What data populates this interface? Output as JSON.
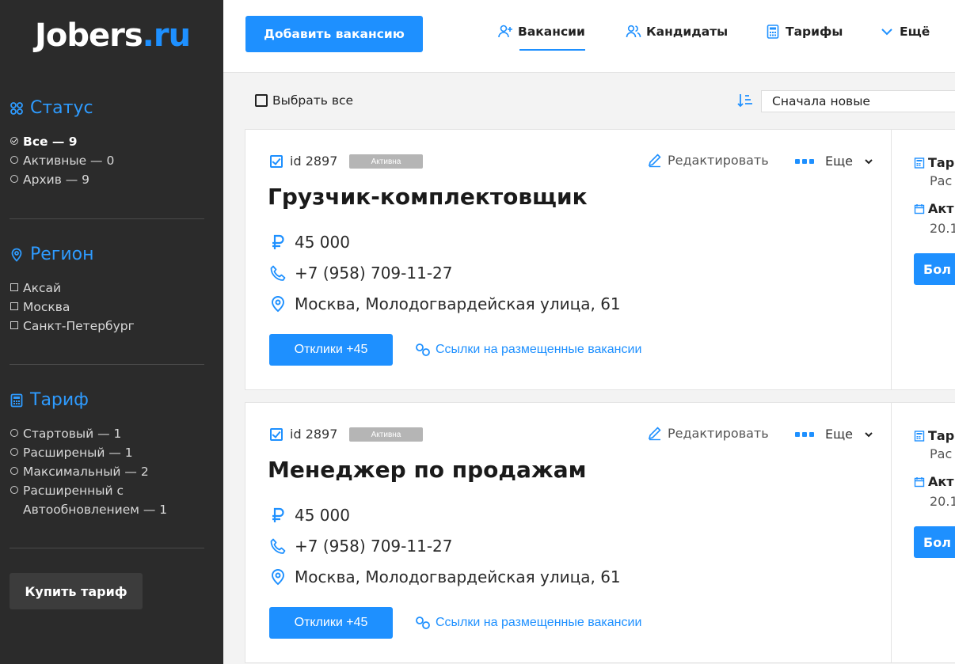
{
  "logo": {
    "main": "Jobers",
    "accent": ".ru"
  },
  "sidebar": {
    "status": {
      "title": "Статус",
      "items": [
        {
          "label": "Все — 9",
          "active": true
        },
        {
          "label": "Активные — 0",
          "active": false
        },
        {
          "label": "Архив — 9",
          "active": false
        }
      ]
    },
    "region": {
      "title": "Регион",
      "items": [
        {
          "label": "Аксай"
        },
        {
          "label": "Москва"
        },
        {
          "label": "Санкт-Петербург"
        }
      ]
    },
    "tariff": {
      "title": "Тариф",
      "items": [
        {
          "label": "Стартовый — 1"
        },
        {
          "label": "Расширеный — 1"
        },
        {
          "label": "Максимальный — 2"
        },
        {
          "label": "Расширенный с Автообновлением — 1"
        }
      ]
    },
    "buy_button": "Купить тариф"
  },
  "topbar": {
    "add_button": "Добавить вакансию",
    "nav": [
      {
        "label": "Вакансии",
        "icon": "user-plus-icon"
      },
      {
        "label": "Кандидаты",
        "icon": "users-icon"
      },
      {
        "label": "Тарифы",
        "icon": "calculator-icon"
      },
      {
        "label": "Ещё",
        "icon": "chevron-down-icon"
      }
    ]
  },
  "toolbar": {
    "select_all": "Выбрать все",
    "sort_value": "Сначала новые"
  },
  "cards": [
    {
      "id": "id 2897",
      "badge": "Активна",
      "edit": "Редактировать",
      "more": "Еще",
      "title": "Грузчик-комплектовщик",
      "salary": "45 000",
      "phone": "+7 (958) 709-11-27",
      "address": "Москва, Молодогвардейская улица, 61",
      "responses": "Отклики +45",
      "links": "Ссылки на размещенные вакансии",
      "right": {
        "tariff_label": "Тар",
        "tariff_value": "Рас",
        "active_label": "Акт",
        "active_value": "20.1",
        "button": "Бол"
      }
    },
    {
      "id": "id 2897",
      "badge": "Активна",
      "edit": "Редактировать",
      "more": "Еще",
      "title": "Менеджер по продажам",
      "salary": "45 000",
      "phone": "+7 (958) 709-11-27",
      "address": "Москва, Молодогвардейская улица, 61",
      "responses": "Отклики +45",
      "links": "Ссылки на размещенные вакансии",
      "right": {
        "tariff_label": "Тар",
        "tariff_value": "Рас",
        "active_label": "Акт",
        "active_value": "20.1",
        "button": "Бол"
      }
    }
  ],
  "colors": {
    "accent": "#1e90ff",
    "sidebar_bg": "#2b2b2b",
    "badge_bg": "#b5b5b5"
  }
}
